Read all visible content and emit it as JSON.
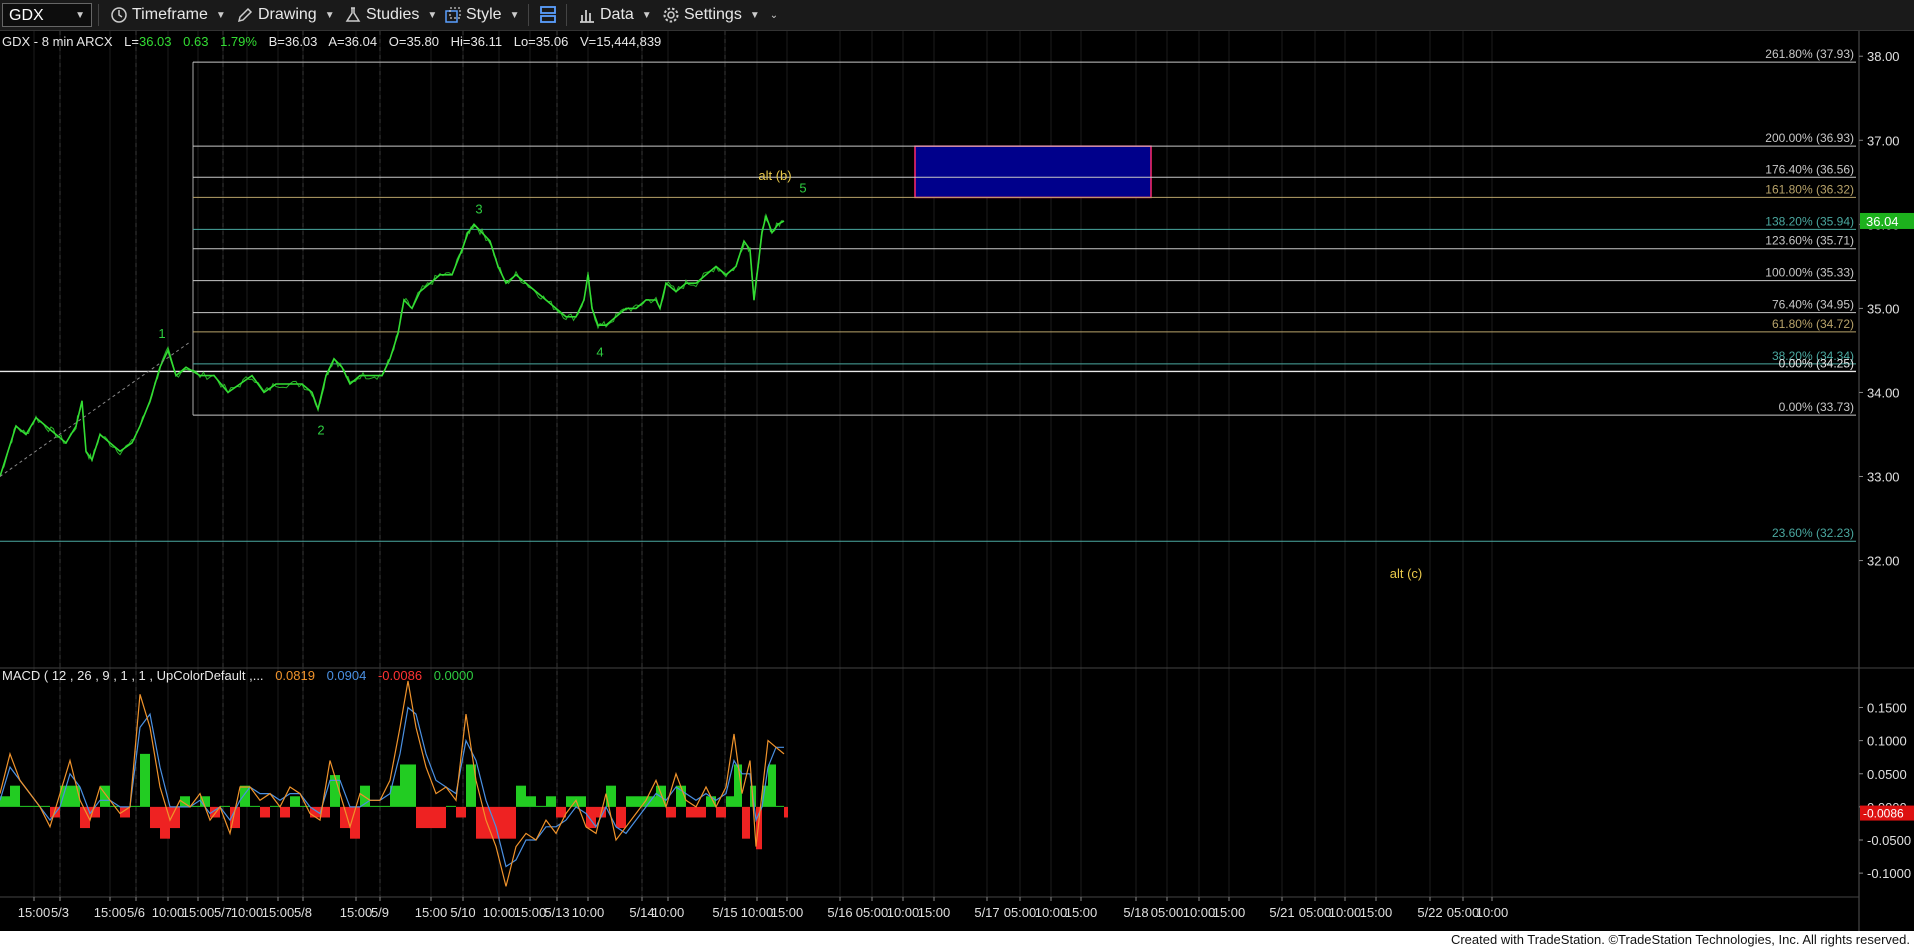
{
  "toolbar": {
    "symbol": "GDX",
    "timeframe_label": "Timeframe",
    "drawing_label": "Drawing",
    "studies_label": "Studies",
    "style_label": "Style",
    "data_label": "Data",
    "settings_label": "Settings"
  },
  "header": {
    "name": "GDX - 8 min  ARCX",
    "fields": [
      {
        "label": "L=",
        "value": "36.03"
      },
      {
        "label": "",
        "value": "0.63"
      },
      {
        "label": "",
        "value": "1.79%"
      },
      {
        "label": "B=",
        "value": "36.03"
      },
      {
        "label": "A=",
        "value": "36.04"
      },
      {
        "label": "O=",
        "value": "35.80"
      },
      {
        "label": "Hi=",
        "value": "36.11"
      },
      {
        "label": "Lo=",
        "value": "35.06"
      },
      {
        "label": "V=",
        "value": "15,444,839"
      }
    ]
  },
  "chart_data": [
    {
      "type": "line",
      "symbol": "GDX",
      "last_price": "36.04",
      "ylim": [
        31.4,
        38.3
      ],
      "y_ticks": [
        "38.00",
        "37.00",
        "36.00",
        "35.00",
        "34.00",
        "33.00",
        "32.00"
      ],
      "price_path": [
        [
          0,
          33.0
        ],
        [
          8,
          33.3
        ],
        [
          16,
          33.6
        ],
        [
          26,
          33.5
        ],
        [
          36,
          33.7
        ],
        [
          46,
          33.6
        ],
        [
          56,
          33.5
        ],
        [
          66,
          33.4
        ],
        [
          76,
          33.6
        ],
        [
          82,
          33.9
        ],
        [
          86,
          33.3
        ],
        [
          92,
          33.2
        ],
        [
          100,
          33.5
        ],
        [
          110,
          33.4
        ],
        [
          120,
          33.3
        ],
        [
          132,
          33.4
        ],
        [
          140,
          33.6
        ],
        [
          150,
          33.9
        ],
        [
          160,
          34.3
        ],
        [
          168,
          34.5
        ],
        [
          176,
          34.2
        ],
        [
          186,
          34.3
        ],
        [
          200,
          34.2
        ],
        [
          214,
          34.2
        ],
        [
          228,
          34.0
        ],
        [
          240,
          34.1
        ],
        [
          252,
          34.2
        ],
        [
          264,
          34.0
        ],
        [
          276,
          34.1
        ],
        [
          290,
          34.1
        ],
        [
          302,
          34.1
        ],
        [
          312,
          34.0
        ],
        [
          318,
          33.8
        ],
        [
          326,
          34.2
        ],
        [
          334,
          34.4
        ],
        [
          342,
          34.3
        ],
        [
          350,
          34.1
        ],
        [
          360,
          34.2
        ],
        [
          372,
          34.2
        ],
        [
          382,
          34.2
        ],
        [
          390,
          34.4
        ],
        [
          398,
          34.7
        ],
        [
          404,
          35.1
        ],
        [
          412,
          35.0
        ],
        [
          420,
          35.2
        ],
        [
          430,
          35.3
        ],
        [
          440,
          35.4
        ],
        [
          452,
          35.4
        ],
        [
          462,
          35.7
        ],
        [
          468,
          35.9
        ],
        [
          474,
          36.0
        ],
        [
          482,
          35.9
        ],
        [
          490,
          35.8
        ],
        [
          498,
          35.5
        ],
        [
          506,
          35.3
        ],
        [
          516,
          35.4
        ],
        [
          526,
          35.3
        ],
        [
          536,
          35.2
        ],
        [
          546,
          35.1
        ],
        [
          556,
          35.0
        ],
        [
          566,
          34.9
        ],
        [
          576,
          34.9
        ],
        [
          584,
          35.1
        ],
        [
          588,
          35.4
        ],
        [
          592,
          35.0
        ],
        [
          598,
          34.8
        ],
        [
          606,
          34.8
        ],
        [
          616,
          34.9
        ],
        [
          626,
          35.0
        ],
        [
          636,
          35.0
        ],
        [
          646,
          35.1
        ],
        [
          656,
          35.1
        ],
        [
          660,
          35.0
        ],
        [
          666,
          35.3
        ],
        [
          676,
          35.2
        ],
        [
          686,
          35.3
        ],
        [
          696,
          35.3
        ],
        [
          706,
          35.4
        ],
        [
          716,
          35.5
        ],
        [
          726,
          35.4
        ],
        [
          736,
          35.5
        ],
        [
          744,
          35.8
        ],
        [
          750,
          35.7
        ],
        [
          754,
          35.1
        ],
        [
          758,
          35.5
        ],
        [
          762,
          35.9
        ],
        [
          766,
          36.1
        ],
        [
          772,
          35.9
        ],
        [
          778,
          36.0
        ],
        [
          784,
          36.04
        ]
      ],
      "fib_levels": [
        {
          "label": "261.80% (37.93)",
          "value": 37.93,
          "color": "#c8c8c8"
        },
        {
          "label": "200.00% (36.93)",
          "value": 36.93,
          "color": "#c8c8c8"
        },
        {
          "label": "176.40% (36.56)",
          "value": 36.56,
          "color": "#c8c8c8"
        },
        {
          "label": "161.80% (36.32)",
          "value": 36.32,
          "color": "#b8a36a"
        },
        {
          "label": "138.20% (35.94)",
          "value": 35.94,
          "color": "#4aa8a0"
        },
        {
          "label": "123.60% (35.71)",
          "value": 35.71,
          "color": "#c8c8c8"
        },
        {
          "label": "100.00% (35.33)",
          "value": 35.33,
          "color": "#c8c8c8"
        },
        {
          "label": "76.40% (34.95)",
          "value": 34.95,
          "color": "#c8c8c8"
        },
        {
          "label": "61.80% (34.72)",
          "value": 34.72,
          "color": "#b8a36a"
        },
        {
          "label": "38.20% (34.34)",
          "value": 34.34,
          "color": "#4aa8a0"
        },
        {
          "label": "0.00% (34.25)",
          "value": 34.25,
          "color": "#e8e8e8"
        },
        {
          "label": "0.00% (33.73)",
          "value": 33.73,
          "color": "#c8c8c8"
        },
        {
          "label": "23.60% (32.23)",
          "value": 32.23,
          "color": "#4aa8a0"
        }
      ],
      "target_box": {
        "low": 36.32,
        "high": 36.93,
        "color": "#00008b"
      },
      "wave_labels": [
        {
          "text": "1",
          "x": 162,
          "y": 34.65,
          "color": "#2ecc40"
        },
        {
          "text": "2",
          "x": 321,
          "y": 33.5,
          "color": "#2ecc40"
        },
        {
          "text": "3",
          "x": 479,
          "y": 36.13,
          "color": "#2ecc40"
        },
        {
          "text": "4",
          "x": 600,
          "y": 34.43,
          "color": "#2ecc40"
        },
        {
          "text": "5",
          "x": 803,
          "y": 36.38,
          "color": "#2ecc40"
        },
        {
          "text": "alt (b)",
          "x": 775,
          "y": 36.53,
          "color": "#e8c84a"
        },
        {
          "text": "alt (c)",
          "x": 1406,
          "y": 31.79,
          "color": "#e8c84a"
        }
      ]
    },
    {
      "type": "line",
      "title": "MACD ( 12 , 26 , 9 , 1 , 1 , UpColorDefault ,...",
      "readouts": [
        {
          "value": "0.0819",
          "color": "#f0932b"
        },
        {
          "value": "0.0904",
          "color": "#4a90e2"
        },
        {
          "value": "-0.0086",
          "color": "#ff3333"
        },
        {
          "value": "0.0000",
          "color": "#2ecc40"
        }
      ],
      "ylim": [
        -0.13,
        0.19
      ],
      "y_ticks": [
        "0.1500",
        "0.1000",
        "0.0500",
        "0.0000",
        "-0.0500",
        "-0.1000"
      ],
      "last_value_tag": "-0.0086",
      "macd_path": [
        [
          0,
          0.02
        ],
        [
          10,
          0.08
        ],
        [
          20,
          0.04
        ],
        [
          30,
          0.02
        ],
        [
          40,
          0.0
        ],
        [
          50,
          -0.03
        ],
        [
          60,
          0.02
        ],
        [
          70,
          0.07
        ],
        [
          80,
          0.01
        ],
        [
          90,
          -0.02
        ],
        [
          100,
          0.03
        ],
        [
          110,
          0.01
        ],
        [
          120,
          -0.01
        ],
        [
          130,
          0.0
        ],
        [
          140,
          0.17
        ],
        [
          150,
          0.12
        ],
        [
          160,
          0.03
        ],
        [
          170,
          -0.02
        ],
        [
          180,
          0.01
        ],
        [
          190,
          0.0
        ],
        [
          200,
          0.02
        ],
        [
          210,
          -0.02
        ],
        [
          220,
          0.0
        ],
        [
          230,
          -0.04
        ],
        [
          240,
          0.03
        ],
        [
          250,
          0.03
        ],
        [
          260,
          0.01
        ],
        [
          270,
          0.02
        ],
        [
          280,
          0.0
        ],
        [
          290,
          0.03
        ],
        [
          300,
          0.02
        ],
        [
          310,
          -0.01
        ],
        [
          320,
          -0.02
        ],
        [
          330,
          0.07
        ],
        [
          340,
          0.02
        ],
        [
          350,
          -0.03
        ],
        [
          360,
          0.02
        ],
        [
          370,
          0.01
        ],
        [
          380,
          0.01
        ],
        [
          390,
          0.04
        ],
        [
          400,
          0.12
        ],
        [
          408,
          0.19
        ],
        [
          416,
          0.12
        ],
        [
          426,
          0.06
        ],
        [
          436,
          0.02
        ],
        [
          446,
          0.03
        ],
        [
          456,
          0.01
        ],
        [
          466,
          0.14
        ],
        [
          476,
          0.04
        ],
        [
          486,
          -0.02
        ],
        [
          496,
          -0.06
        ],
        [
          506,
          -0.12
        ],
        [
          516,
          -0.06
        ],
        [
          526,
          -0.04
        ],
        [
          536,
          -0.05
        ],
        [
          546,
          -0.02
        ],
        [
          556,
          -0.04
        ],
        [
          566,
          -0.01
        ],
        [
          576,
          0.01
        ],
        [
          586,
          -0.03
        ],
        [
          596,
          -0.04
        ],
        [
          606,
          0.02
        ],
        [
          616,
          -0.05
        ],
        [
          626,
          -0.03
        ],
        [
          636,
          -0.01
        ],
        [
          646,
          0.01
        ],
        [
          656,
          0.04
        ],
        [
          666,
          0.0
        ],
        [
          676,
          0.05
        ],
        [
          686,
          0.01
        ],
        [
          696,
          0.0
        ],
        [
          706,
          0.03
        ],
        [
          716,
          0.0
        ],
        [
          726,
          0.03
        ],
        [
          734,
          0.11
        ],
        [
          742,
          0.02
        ],
        [
          750,
          0.07
        ],
        [
          756,
          -0.06
        ],
        [
          762,
          0.02
        ],
        [
          768,
          0.1
        ],
        [
          776,
          0.09
        ],
        [
          784,
          0.08
        ]
      ],
      "signal_path": [
        [
          0,
          0.01
        ],
        [
          10,
          0.06
        ],
        [
          20,
          0.04
        ],
        [
          30,
          0.02
        ],
        [
          40,
          0.0
        ],
        [
          50,
          -0.02
        ],
        [
          60,
          0.0
        ],
        [
          70,
          0.05
        ],
        [
          80,
          0.03
        ],
        [
          90,
          -0.01
        ],
        [
          100,
          0.01
        ],
        [
          110,
          0.01
        ],
        [
          120,
          0.0
        ],
        [
          130,
          0.0
        ],
        [
          140,
          0.12
        ],
        [
          150,
          0.14
        ],
        [
          160,
          0.06
        ],
        [
          170,
          0.0
        ],
        [
          180,
          0.0
        ],
        [
          190,
          0.0
        ],
        [
          200,
          0.01
        ],
        [
          210,
          -0.01
        ],
        [
          220,
          0.0
        ],
        [
          230,
          -0.02
        ],
        [
          240,
          0.01
        ],
        [
          250,
          0.03
        ],
        [
          260,
          0.02
        ],
        [
          270,
          0.02
        ],
        [
          280,
          0.01
        ],
        [
          290,
          0.02
        ],
        [
          300,
          0.02
        ],
        [
          310,
          0.0
        ],
        [
          320,
          -0.01
        ],
        [
          330,
          0.04
        ],
        [
          340,
          0.04
        ],
        [
          350,
          0.0
        ],
        [
          360,
          0.0
        ],
        [
          370,
          0.01
        ],
        [
          380,
          0.01
        ],
        [
          390,
          0.02
        ],
        [
          400,
          0.08
        ],
        [
          408,
          0.15
        ],
        [
          416,
          0.14
        ],
        [
          426,
          0.08
        ],
        [
          436,
          0.04
        ],
        [
          446,
          0.03
        ],
        [
          456,
          0.02
        ],
        [
          466,
          0.1
        ],
        [
          476,
          0.07
        ],
        [
          486,
          0.01
        ],
        [
          496,
          -0.03
        ],
        [
          506,
          -0.09
        ],
        [
          516,
          -0.08
        ],
        [
          526,
          -0.05
        ],
        [
          536,
          -0.05
        ],
        [
          546,
          -0.03
        ],
        [
          556,
          -0.03
        ],
        [
          566,
          -0.02
        ],
        [
          576,
          0.0
        ],
        [
          586,
          -0.01
        ],
        [
          596,
          -0.03
        ],
        [
          606,
          0.0
        ],
        [
          616,
          -0.03
        ],
        [
          626,
          -0.04
        ],
        [
          636,
          -0.02
        ],
        [
          646,
          0.0
        ],
        [
          656,
          0.02
        ],
        [
          666,
          0.01
        ],
        [
          676,
          0.03
        ],
        [
          686,
          0.02
        ],
        [
          696,
          0.01
        ],
        [
          706,
          0.02
        ],
        [
          716,
          0.01
        ],
        [
          726,
          0.02
        ],
        [
          734,
          0.07
        ],
        [
          742,
          0.05
        ],
        [
          750,
          0.05
        ],
        [
          756,
          -0.02
        ],
        [
          762,
          0.0
        ],
        [
          768,
          0.06
        ],
        [
          776,
          0.09
        ],
        [
          784,
          0.09
        ]
      ]
    }
  ],
  "time_axis": [
    {
      "label": "15:00",
      "x": 34
    },
    {
      "label": "5/3",
      "x": 60
    },
    {
      "label": "15:00",
      "x": 110
    },
    {
      "label": "5/6",
      "x": 136
    },
    {
      "label": "10:00",
      "x": 168
    },
    {
      "label": "15:00",
      "x": 198
    },
    {
      "label": "5/7",
      "x": 223
    },
    {
      "label": "10:00",
      "x": 247
    },
    {
      "label": "15:00",
      "x": 278
    },
    {
      "label": "5/8",
      "x": 303
    },
    {
      "label": "15:00",
      "x": 356
    },
    {
      "label": "5/9",
      "x": 380
    },
    {
      "label": "15:00",
      "x": 431
    },
    {
      "label": "5/10",
      "x": 463
    },
    {
      "label": "10:00",
      "x": 499
    },
    {
      "label": "15:00",
      "x": 530
    },
    {
      "label": "5/13",
      "x": 557
    },
    {
      "label": "10:00",
      "x": 588
    },
    {
      "label": "5/14",
      "x": 642
    },
    {
      "label": "10:00",
      "x": 668
    },
    {
      "label": "5/15",
      "x": 725
    },
    {
      "label": "10:00",
      "x": 757
    },
    {
      "label": "15:00",
      "x": 787
    },
    {
      "label": "5/16",
      "x": 840
    },
    {
      "label": "05:00",
      "x": 872
    },
    {
      "label": "10:00",
      "x": 903
    },
    {
      "label": "15:00",
      "x": 934
    },
    {
      "label": "5/17",
      "x": 987
    },
    {
      "label": "05:00",
      "x": 1020
    },
    {
      "label": "10:00",
      "x": 1051
    },
    {
      "label": "15:00",
      "x": 1081
    },
    {
      "label": "5/18",
      "x": 1136
    },
    {
      "label": "05:00",
      "x": 1167
    },
    {
      "label": "10:00",
      "x": 1199
    },
    {
      "label": "15:00",
      "x": 1229
    },
    {
      "label": "5/21",
      "x": 1282
    },
    {
      "label": "05:00",
      "x": 1315
    },
    {
      "label": "10:00",
      "x": 1345
    },
    {
      "label": "15:00",
      "x": 1376
    },
    {
      "label": "5/22",
      "x": 1430
    },
    {
      "label": "05:00",
      "x": 1463
    },
    {
      "label": "10:00",
      "x": 1492
    }
  ],
  "day_separators": [
    60,
    136,
    223,
    303,
    380,
    463,
    557,
    642,
    725
  ],
  "footer_text": "Created with TradeStation. ©TradeStation Technologies, Inc. All rights reserved.",
  "colors": {
    "price": "#33dd33",
    "macd": "#f0932b",
    "signal": "#4a90e2",
    "hist_up": "#22cc22",
    "hist_down": "#ee2222",
    "last_price_tag": "#1db11d"
  }
}
